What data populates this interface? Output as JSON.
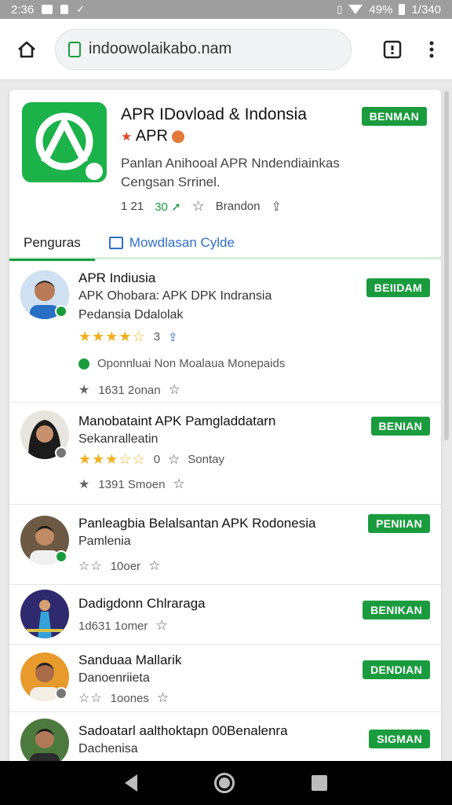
{
  "status_bar": {
    "time": "2:36",
    "battery": "49%",
    "clock_right": "1/340"
  },
  "browser": {
    "url": "indoowolaikabo.nam"
  },
  "app": {
    "title": "APR IDovload & Indonsia",
    "subtitle": "APR",
    "description": "Panlan Anihooal APR Nndendiainkas Cengsan Srrinel.",
    "meta_count": "1 21",
    "meta_dl": "30",
    "meta_label": "Brandon",
    "button": "BENMAN"
  },
  "tabs": [
    {
      "label": "Penguras"
    },
    {
      "label": "Mowdlasan Cylde"
    }
  ],
  "items": [
    {
      "title": "APR Indiusia",
      "line1": "APK Ohobara: APK DPK Indransia",
      "line2": "Pedansia Ddalolak",
      "stars_count": "3",
      "extra": "Oponnluai Non Moalaua Monepaids",
      "meta": "1631 2onan",
      "button": "BEIIDAM"
    },
    {
      "title": "Manobataint APK Pamgladdatarn",
      "line1": "Sekanralleatin",
      "stars_count": "0",
      "stars_label": "Sontay",
      "meta": "1391 Smoen",
      "button": "BENIAN"
    },
    {
      "title": "Panleagbia Belalsantan APK Rodonesia",
      "line1": "Pamlenia",
      "meta": "10oer",
      "button": "PENIIAN"
    },
    {
      "title": "Dadigdonn Chlraraga",
      "meta": "1d631 1omer",
      "button": "BENIKAN"
    },
    {
      "title": "Sanduaa Mallarik",
      "line1": "Danoenriieta",
      "meta": "1oones",
      "button": "DENDIAN"
    },
    {
      "title": "Sadoatarl aalthoktapn 00Benalenra",
      "line1": "Dachenisa",
      "button": "SIGMAN"
    }
  ],
  "colors": {
    "accent_green": "#1a9c3e",
    "link_blue": "#2f6fc8",
    "star": "#f2b01e"
  }
}
